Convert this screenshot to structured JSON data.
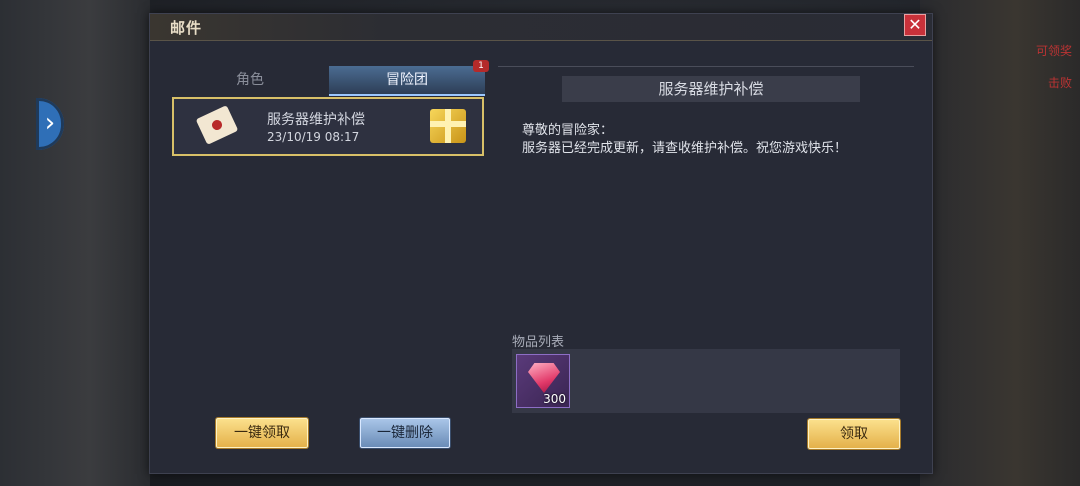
{
  "window": {
    "title": "邮件"
  },
  "tabs": [
    {
      "label": "角色"
    },
    {
      "label": "冒险团",
      "badge": "1",
      "selected": true
    }
  ],
  "mail_list": [
    {
      "title": "服务器维护补偿",
      "time": "23/10/19 08:17",
      "icon": "envelope-icon",
      "attachment_icon": "gift-box-icon"
    }
  ],
  "buttons": {
    "claim_all": "一键领取",
    "delete_all": "一键删除",
    "claim": "领取"
  },
  "detail": {
    "header": "服务器维护补偿",
    "greeting": "尊敬的冒险家：",
    "body": "服务器已经完成更新，请查收维护补偿。祝您游戏快乐！",
    "items_label": "物品列表",
    "items": [
      {
        "icon": "gem-icon",
        "quantity": "300"
      }
    ]
  },
  "hud": {
    "right_text_1": "可领奖",
    "right_text_2": "击败"
  },
  "colors": {
    "accent_gold": "#d8c068",
    "close_red": "#c8313a",
    "tab_blue": "#4b6c92"
  }
}
